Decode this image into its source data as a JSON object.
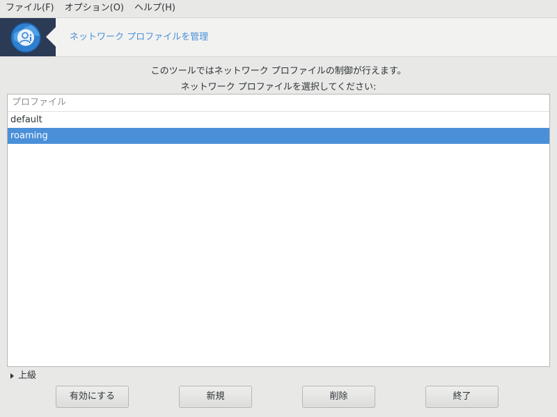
{
  "menubar": {
    "items": [
      "ファイル(F)",
      "オプション(O)",
      "ヘルプ(H)"
    ]
  },
  "banner": {
    "icon": "network-profile-globe-icon",
    "title": "ネットワーク プロファイルを管理"
  },
  "description": {
    "line1": "このツールではネットワーク プロファイルの制御が行えます。",
    "line2": "ネットワーク プロファイルを選択してください:"
  },
  "profile_list": {
    "header": "プロファイル",
    "rows": [
      {
        "label": "default",
        "selected": false
      },
      {
        "label": "roaming",
        "selected": true
      }
    ]
  },
  "advanced": {
    "label": "上級",
    "expanded": false
  },
  "buttons": {
    "enable": "有効にする",
    "new": "新規",
    "delete": "削除",
    "quit": "終了"
  },
  "colors": {
    "accent": "#4a90d9",
    "banner_dark": "#2b3a55",
    "title_blue": "#4a8fd8"
  }
}
